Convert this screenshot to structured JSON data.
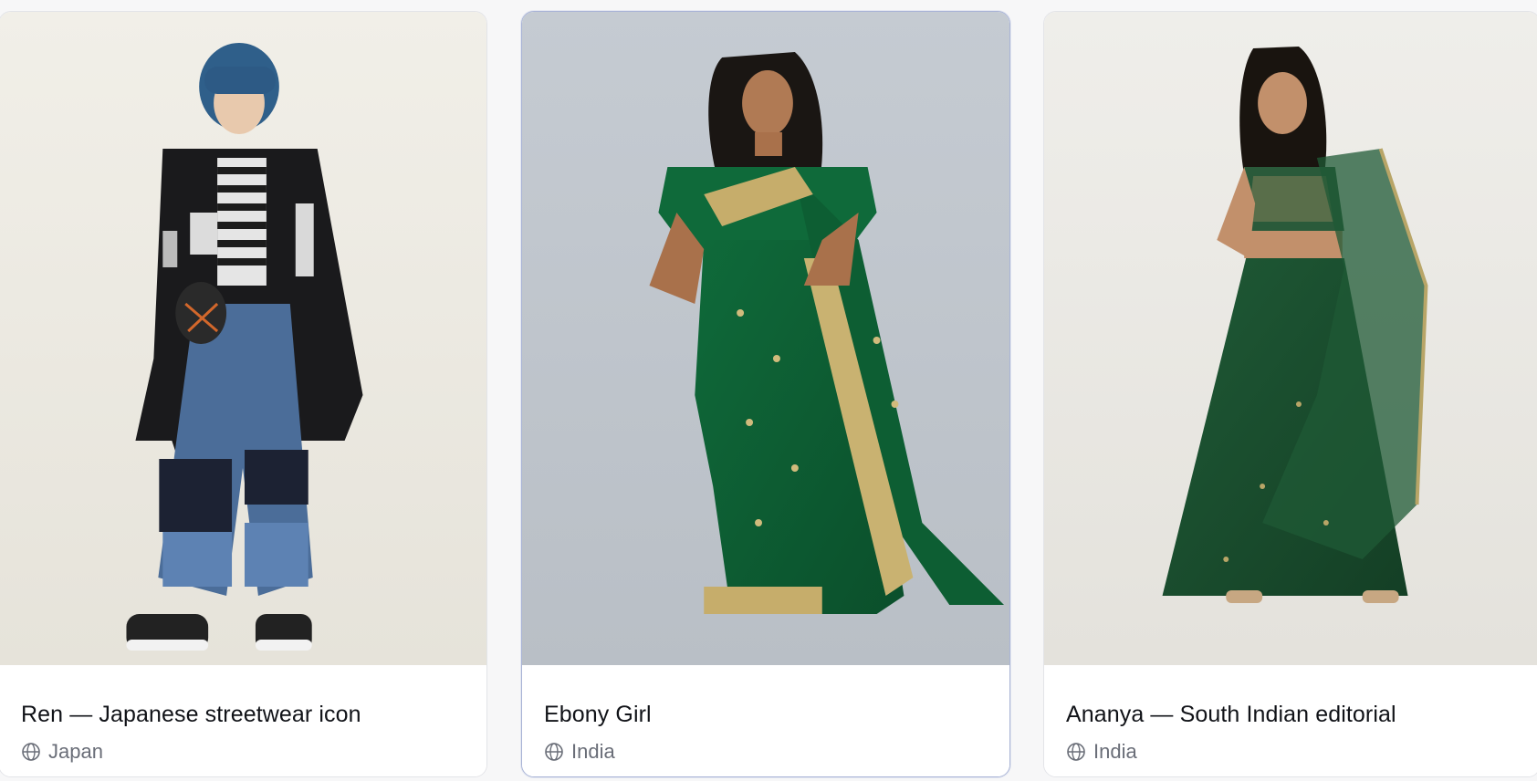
{
  "cards": [
    {
      "title": "Ren — Japanese streetwear icon",
      "location": "Japan",
      "location_icon": "globe-icon",
      "photo_bg": "#efede6"
    },
    {
      "title": "Ebony Girl",
      "location": "India",
      "location_icon": "globe-icon",
      "photo_bg": "#c3c9cf",
      "selected": true
    },
    {
      "title": "Ananya — South Indian editorial",
      "location": "India",
      "location_icon": "globe-icon",
      "photo_bg": "#eeece7"
    }
  ],
  "colors": {
    "card_border": "#e3e4e8",
    "selected_border": "#a9b4d6",
    "title_text": "#111318",
    "location_text": "#6a6e78"
  }
}
